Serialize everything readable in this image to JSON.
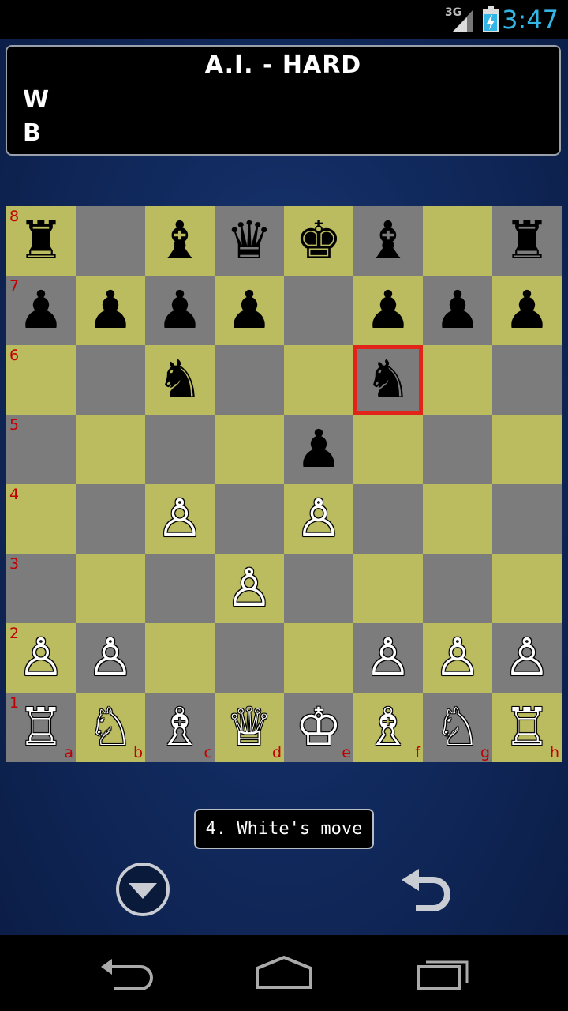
{
  "status_bar": {
    "time": "3:47",
    "network": "3G"
  },
  "header": {
    "title": "A.I. - HARD",
    "white_label": "W",
    "black_label": "B"
  },
  "board": {
    "colors": {
      "light": "#bbbb60",
      "dark": "#7c7c7c",
      "selection": "#e2231a",
      "coordinate": "#c00000"
    },
    "selected_square": "f6",
    "rank_labels": [
      "8",
      "7",
      "6",
      "5",
      "4",
      "3",
      "2",
      "1"
    ],
    "file_labels": [
      "a",
      "b",
      "c",
      "d",
      "e",
      "f",
      "g",
      "h"
    ],
    "pieces": {
      "a8": "br",
      "c8": "bb",
      "d8": "bq",
      "e8": "bk",
      "f8": "bb",
      "h8": "br",
      "a7": "bp",
      "b7": "bp",
      "c7": "bp",
      "d7": "bp",
      "f7": "bp",
      "g7": "bp",
      "h7": "bp",
      "c6": "bn",
      "f6": "bn",
      "e5": "bp",
      "c4": "wp",
      "e4": "wp",
      "d3": "wp",
      "a2": "wp",
      "b2": "wp",
      "f2": "wp",
      "g2": "wp",
      "h2": "wp",
      "a1": "wr",
      "b1": "wn",
      "c1": "wb",
      "d1": "wq",
      "e1": "wk",
      "f1": "wb",
      "g1": "wn",
      "h1": "wr"
    }
  },
  "move_status": "4. White's move",
  "controls": {
    "menu_icon": "chevron-down-circle-icon",
    "undo_icon": "undo-arrow-icon"
  },
  "nav_bar": {
    "back_icon": "back-icon",
    "home_icon": "home-icon",
    "recents_icon": "recents-icon"
  }
}
